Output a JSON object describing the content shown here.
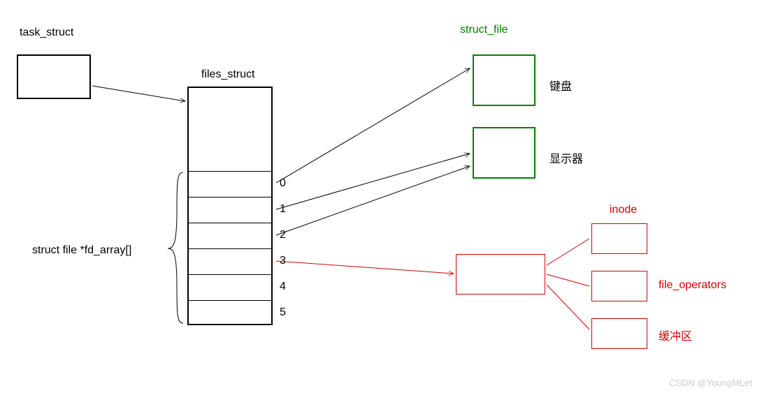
{
  "labels": {
    "task_struct": "task_struct",
    "files_struct": "files_struct",
    "fd_array": "struct file *fd_array[]",
    "struct_file_green": "struct_file",
    "keyboard": "键盘",
    "display": "显示器",
    "inode": "inode",
    "file_operators": "file_operators",
    "buffer": "缓冲区",
    "idx0": "0",
    "idx1": "1",
    "idx2": "2",
    "idx3": "3",
    "idx4": "4",
    "idx5": "5",
    "watermark": "CSDN @YoungMLet"
  }
}
